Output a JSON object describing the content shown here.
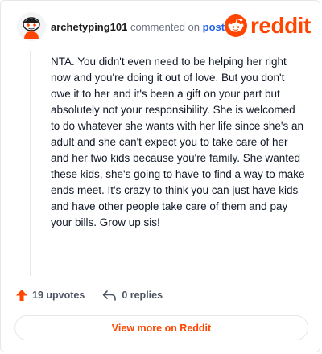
{
  "comment": {
    "username": "archetyping101",
    "action_text": "commented on",
    "post_link": "post",
    "body": "NTA. You didn't even need to be helping her right now and you're doing it out of love. But you don't owe it to her and it's been a gift on your part but absolutely not your responsibility. She is welcomed to do whatever she wants with her life since she's an adult and she can't expect you to take care of her and her two kids because you're family. She wanted these kids, she's going to have to find a way to make ends meet. It's crazy to think you can just have kids and have other people take care of them and pay your bills. Grow up sis!",
    "upvotes": "19 upvotes",
    "replies": "0 replies"
  },
  "brand": {
    "wordmark": "reddit",
    "color": "#ff4500"
  },
  "view_more_label": "View more on Reddit",
  "icons": [
    "user-avatar",
    "reddit-logo-icon",
    "upvote-arrow-icon",
    "reply-icon"
  ]
}
